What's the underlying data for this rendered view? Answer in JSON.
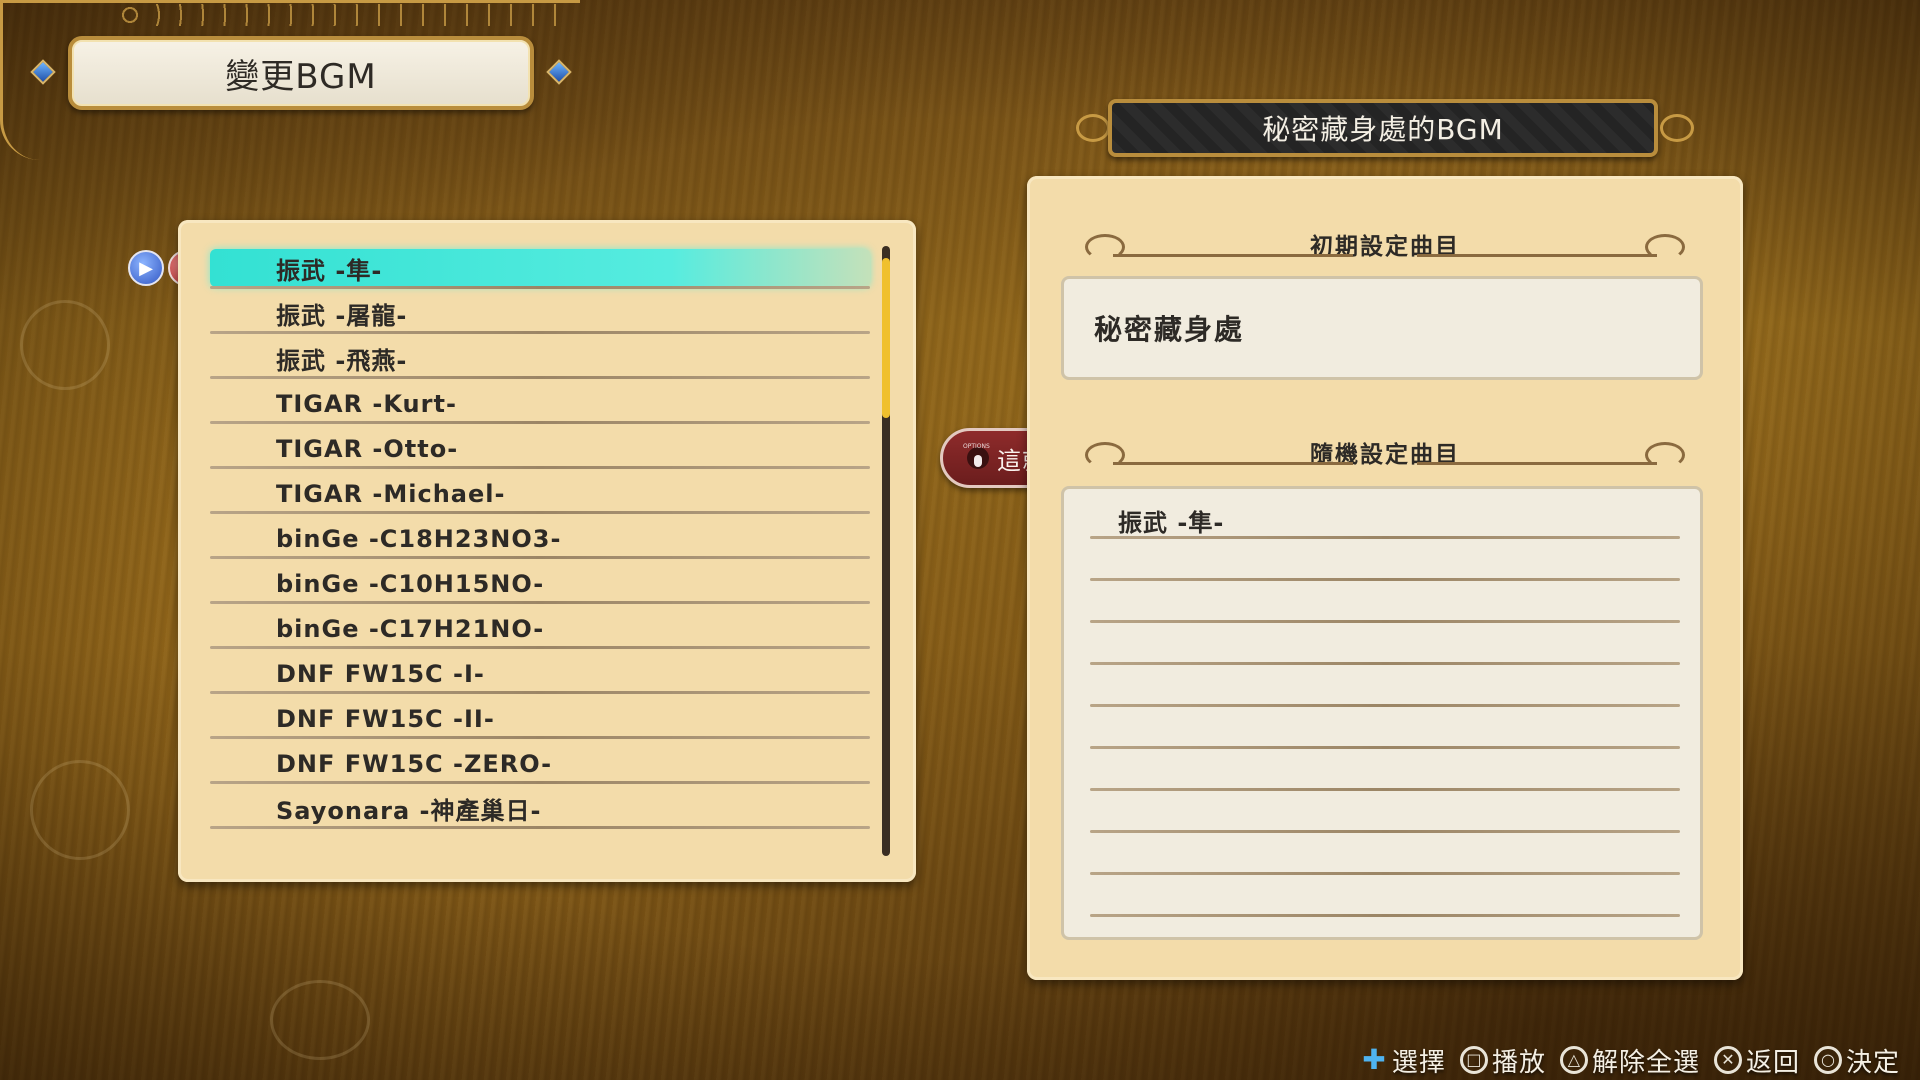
{
  "header": {
    "title": "變更BGM",
    "location_banner": "秘密藏身處的BGM"
  },
  "track_list": {
    "items": [
      {
        "label": "振武 -隼-",
        "selected": true
      },
      {
        "label": "振武 -屠龍-",
        "selected": false
      },
      {
        "label": "振武 -飛燕-",
        "selected": false
      },
      {
        "label": "TIGAR -Kurt-",
        "selected": false
      },
      {
        "label": "TIGAR -Otto-",
        "selected": false
      },
      {
        "label": "TIGAR -Michael-",
        "selected": false
      },
      {
        "label": "binGe -C18H23NO3-",
        "selected": false
      },
      {
        "label": "binGe -C10H15NO-",
        "selected": false
      },
      {
        "label": "binGe -C17H21NO-",
        "selected": false
      },
      {
        "label": "DNF FW15C -I-",
        "selected": false
      },
      {
        "label": "DNF FW15C -II-",
        "selected": false
      },
      {
        "label": "DNF FW15C -ZERO-",
        "selected": false
      },
      {
        "label": "Sayonara -神產巢日-",
        "selected": false
      }
    ],
    "scroll_position": 0.0,
    "cursor_icons": [
      "play-icon",
      "music-note-icon"
    ]
  },
  "settings": {
    "default_heading": "初期設定曲目",
    "default_track": "秘密藏身處",
    "random_heading": "隨機設定曲目",
    "random_tracks": [
      "振武 -隼-",
      "",
      "",
      "",
      "",
      "",
      "",
      "",
      "",
      ""
    ]
  },
  "ok_button": {
    "label": "這就OK了",
    "button_icon": "options-button-icon",
    "button_caption": "OPTIONS"
  },
  "controls": [
    {
      "icon": "dpad-icon",
      "glyph": "✚",
      "label": "選擇"
    },
    {
      "icon": "square-button-icon",
      "glyph": "□",
      "label": "播放"
    },
    {
      "icon": "triangle-button-icon",
      "glyph": "△",
      "label": "解除全選"
    },
    {
      "icon": "cross-button-icon",
      "glyph": "✕",
      "label": "返回"
    },
    {
      "icon": "circle-button-icon",
      "glyph": "○",
      "label": "決定"
    }
  ],
  "colors": {
    "highlight": "#33e1d3",
    "panel": "#f3dcaa",
    "ok_button": "#8e2b2b",
    "scroll_thumb": "#f0c02d"
  }
}
